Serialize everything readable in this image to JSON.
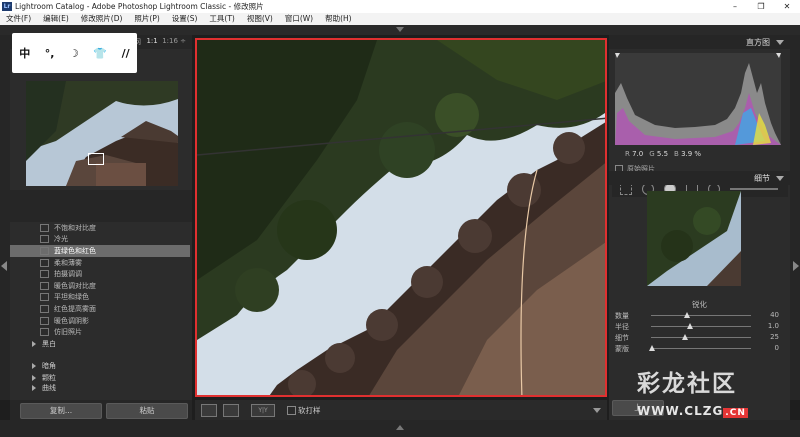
{
  "window": {
    "title": "Lightroom Catalog - Adobe Photoshop Lightroom Classic - 修改照片",
    "app_icon": "Lr"
  },
  "menu": [
    "文件(F)",
    "编辑(E)",
    "修改照片(D)",
    "照片(P)",
    "设置(S)",
    "工具(T)",
    "视图(V)",
    "窗口(W)",
    "帮助(H)"
  ],
  "watermark_badge": [
    "中",
    "°,",
    "☽",
    "👕",
    "//"
  ],
  "navigator": {
    "zoom_levels": [
      "1:1",
      "1:16 ÷"
    ],
    "header_fragment": "网"
  },
  "presets": {
    "items": [
      {
        "label": "不饱和对比度",
        "selected": false
      },
      {
        "label": "冷光",
        "selected": false
      },
      {
        "label": "蓝绿色和红色",
        "selected": true
      },
      {
        "label": "柔和薄雾",
        "selected": false
      },
      {
        "label": "拍摄调调",
        "selected": false
      },
      {
        "label": "暖色调对比度",
        "selected": false
      },
      {
        "label": "平坦和绿色",
        "selected": false
      },
      {
        "label": "红色提高雾面",
        "selected": false
      },
      {
        "label": "暖色调阴影",
        "selected": false
      },
      {
        "label": "仿旧照片",
        "selected": false
      }
    ],
    "folders": [
      "黑白",
      "暗角",
      "颗粒",
      "曲线"
    ]
  },
  "left_buttons": {
    "copy": "复制...",
    "paste": "粘贴"
  },
  "toolbar": {
    "soft_proof": "软打样",
    "ratio_label": "Y|Y"
  },
  "histogram": {
    "title": "直方图",
    "readout": {
      "R": "7.0",
      "G": "5.5",
      "B": "3.9 %"
    },
    "original_label": "原始照片"
  },
  "detail": {
    "title": "细节",
    "sharpen_title": "锐化",
    "sliders": [
      {
        "label": "数量",
        "value": "40",
        "fraction": 0.27
      },
      {
        "label": "半径",
        "value": "1.0",
        "fraction": 0.3
      },
      {
        "label": "细节",
        "value": "25",
        "fraction": 0.25
      },
      {
        "label": "蒙版",
        "value": "0",
        "fraction": 0.0
      }
    ]
  },
  "right_buttons": {
    "prev": "上"
  },
  "logo_watermark": {
    "name": "彩龙社区",
    "url": "WWW.CLZG",
    "tld": ".CN"
  }
}
